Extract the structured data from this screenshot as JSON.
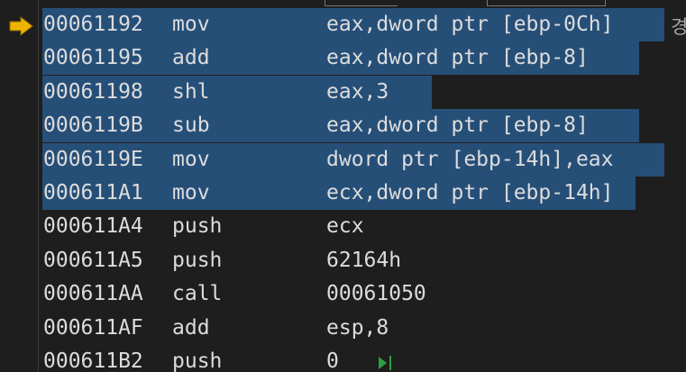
{
  "margin": {
    "current_instruction_icon": "arrow-right-icon",
    "arrow_color": "#f0b400"
  },
  "side_text": "경",
  "colors": {
    "selection": "#264f78",
    "text": "#dcdcdc",
    "background": "#1e1e1e",
    "run_icon": "#2ea043"
  },
  "instructions": [
    {
      "address": "00061192",
      "mnemonic": "mov",
      "operands": "eax,dword ptr [ebp-0Ch]",
      "selected": true
    },
    {
      "address": "00061195",
      "mnemonic": "add",
      "operands": "eax,dword ptr [ebp-8]",
      "selected": true
    },
    {
      "address": "00061198",
      "mnemonic": "shl",
      "operands": "eax,3",
      "selected": true
    },
    {
      "address": "0006119B",
      "mnemonic": "sub",
      "operands": "eax,dword ptr [ebp-8]",
      "selected": true
    },
    {
      "address": "0006119E",
      "mnemonic": "mov",
      "operands": "dword ptr [ebp-14h],eax",
      "selected": true
    },
    {
      "address": "000611A1",
      "mnemonic": "mov",
      "operands": "ecx,dword ptr [ebp-14h]",
      "selected": true
    },
    {
      "address": "000611A4",
      "mnemonic": "push",
      "operands": "ecx",
      "selected": false
    },
    {
      "address": "000611A5",
      "mnemonic": "push",
      "operands": "62164h",
      "selected": false
    },
    {
      "address": "000611AA",
      "mnemonic": "call",
      "operands": "00061050",
      "selected": false
    },
    {
      "address": "000611AF",
      "mnemonic": "add",
      "operands": "esp,8",
      "selected": false
    },
    {
      "address": "000611B2",
      "mnemonic": "push",
      "operands": "0",
      "selected": false
    }
  ],
  "run_to_cursor_icon": "run-to-cursor-icon"
}
